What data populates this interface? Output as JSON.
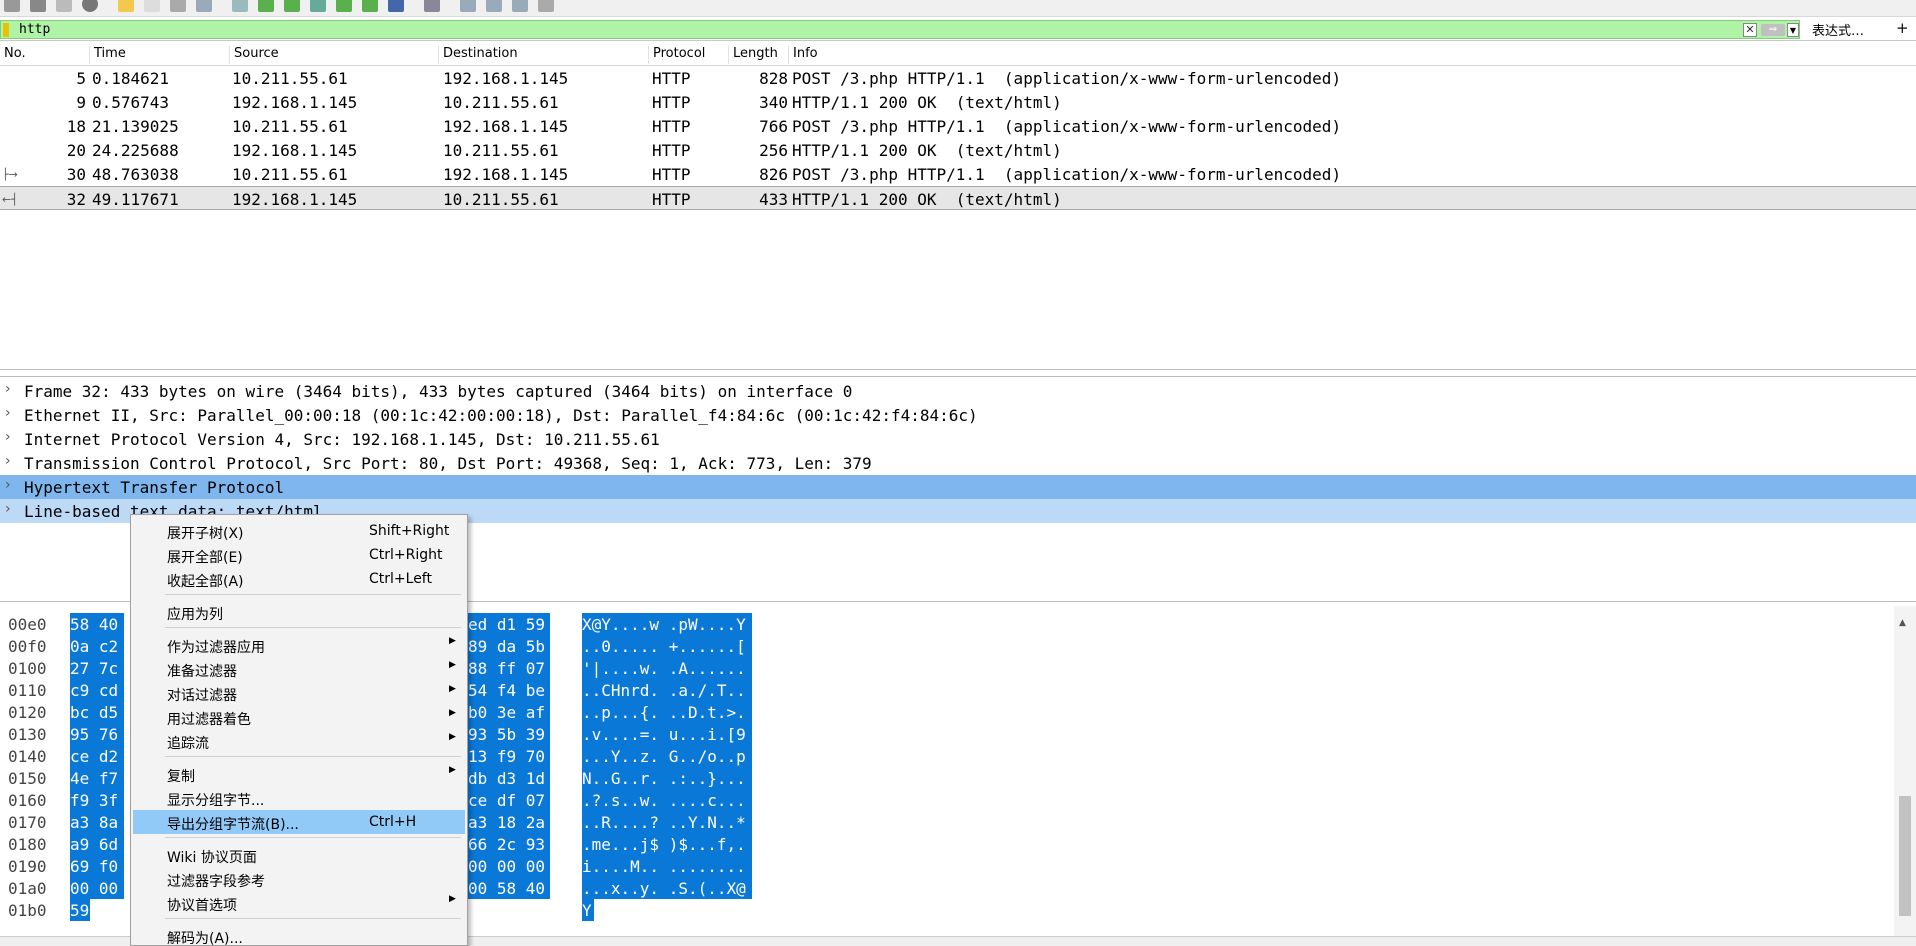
{
  "filter": {
    "value": "http",
    "expression_label": "表达式…",
    "add_label": "+"
  },
  "packet_list": {
    "columns": [
      "No.",
      "Time",
      "Source",
      "Destination",
      "Protocol",
      "Length",
      "Info"
    ],
    "rows": [
      {
        "no": "5",
        "time": "0.184621",
        "src": "10.211.55.61",
        "dst": "192.168.1.145",
        "proto": "HTTP",
        "len": "828",
        "info": "POST /3.php HTTP/1.1  (application/x-www-form-urlencoded)"
      },
      {
        "no": "9",
        "time": "0.576743",
        "src": "192.168.1.145",
        "dst": "10.211.55.61",
        "proto": "HTTP",
        "len": "340",
        "info": "HTTP/1.1 200 OK  (text/html)"
      },
      {
        "no": "18",
        "time": "21.139025",
        "src": "10.211.55.61",
        "dst": "192.168.1.145",
        "proto": "HTTP",
        "len": "766",
        "info": "POST /3.php HTTP/1.1  (application/x-www-form-urlencoded)"
      },
      {
        "no": "20",
        "time": "24.225688",
        "src": "192.168.1.145",
        "dst": "10.211.55.61",
        "proto": "HTTP",
        "len": "256",
        "info": "HTTP/1.1 200 OK  (text/html)"
      },
      {
        "no": "30",
        "time": "48.763038",
        "src": "10.211.55.61",
        "dst": "192.168.1.145",
        "proto": "HTTP",
        "len": "826",
        "info": "POST /3.php HTTP/1.1  (application/x-www-form-urlencoded)"
      },
      {
        "no": "32",
        "time": "49.117671",
        "src": "192.168.1.145",
        "dst": "10.211.55.61",
        "proto": "HTTP",
        "len": "433",
        "info": "HTTP/1.1 200 OK  (text/html)"
      }
    ],
    "selected_row_no": "32"
  },
  "details": [
    "Frame 32: 433 bytes on wire (3464 bits), 433 bytes captured (3464 bits) on interface 0",
    "Ethernet II, Src: Parallel_00:00:18 (00:1c:42:00:00:18), Dst: Parallel_f4:84:6c (00:1c:42:f4:84:6c)",
    "Internet Protocol Version 4, Src: 192.168.1.145, Dst: 10.211.55.61",
    "Transmission Control Protocol, Src Port: 80, Dst Port: 49368, Seq: 1, Ack: 773, Len: 379",
    "Hypertext Transfer Protocol",
    "Line-based text data: text/html"
  ],
  "hex": [
    {
      "off": "00e0",
      "left": "58 40",
      "right": "ed d1 59",
      "ascii": "X@Y....w .pW....Y"
    },
    {
      "off": "00f0",
      "left": "0a c2",
      "right": "89 da 5b",
      "ascii": "..0..... +......["
    },
    {
      "off": "0100",
      "left": "27 7c",
      "right": "88 ff 07",
      "ascii": "'|....w. .A......"
    },
    {
      "off": "0110",
      "left": "c9 cd",
      "right": "54 f4 be",
      "ascii": "..CHnrd. .a./.T.."
    },
    {
      "off": "0120",
      "left": "bc d5",
      "right": "b0 3e af",
      "ascii": "..p...{. ..D.t.>."
    },
    {
      "off": "0130",
      "left": "95 76",
      "right": "93 5b 39",
      "ascii": ".v....=. u...i.[9"
    },
    {
      "off": "0140",
      "left": "ce d2",
      "right": "13 f9 70",
      "ascii": "...Y..z. G../o..p"
    },
    {
      "off": "0150",
      "left": "4e f7",
      "right": "db d3 1d",
      "ascii": "N..G..r. .:..}..."
    },
    {
      "off": "0160",
      "left": "f9 3f",
      "right": "ce df 07",
      "ascii": ".?.s..w. ....c..."
    },
    {
      "off": "0170",
      "left": "a3 8a",
      "right": "a3 18 2a",
      "ascii": "..R....? ..Y.N..*"
    },
    {
      "off": "0180",
      "left": "a9 6d",
      "right": "66 2c 93",
      "ascii": ".me...j$ )$...f,."
    },
    {
      "off": "0190",
      "left": "69 f0",
      "right": "00 00 00",
      "ascii": "i....M.. ........"
    },
    {
      "off": "01a0",
      "left": "00 00",
      "right": "00 58 40",
      "ascii": "...x..y. .S.(..X@"
    },
    {
      "off": "01b0",
      "left": "59",
      "right": "",
      "ascii": "Y"
    }
  ],
  "context_menu": {
    "items": [
      {
        "label": "展开子树(X)",
        "shortcut": "Shift+Right",
        "submenu": false
      },
      {
        "label": "展开全部(E)",
        "shortcut": "Ctrl+Right",
        "submenu": false
      },
      {
        "label": "收起全部(A)",
        "shortcut": "Ctrl+Left",
        "submenu": false
      },
      {
        "label": "应用为列",
        "shortcut": "",
        "submenu": false
      },
      {
        "label": "作为过滤器应用",
        "shortcut": "",
        "submenu": true
      },
      {
        "label": "准备过滤器",
        "shortcut": "",
        "submenu": true
      },
      {
        "label": "对话过滤器",
        "shortcut": "",
        "submenu": true
      },
      {
        "label": "用过滤器着色",
        "shortcut": "",
        "submenu": true
      },
      {
        "label": "追踪流",
        "shortcut": "",
        "submenu": true
      },
      {
        "label": "复制",
        "shortcut": "",
        "submenu": true
      },
      {
        "label": "显示分组字节...",
        "shortcut": "",
        "submenu": false
      },
      {
        "label": "导出分组字节流(B)...",
        "shortcut": "Ctrl+H",
        "submenu": false
      },
      {
        "label": "Wiki 协议页面",
        "shortcut": "",
        "submenu": false
      },
      {
        "label": "过滤器字段参考",
        "shortcut": "",
        "submenu": false
      },
      {
        "label": "协议首选项",
        "shortcut": "",
        "submenu": true
      },
      {
        "label": "解码为(A)...",
        "shortcut": "",
        "submenu": false
      }
    ],
    "active_index": 11
  },
  "colors": {
    "filter_valid": "#aff3a6",
    "detail_highlight": "#7fb6ee",
    "hex_selection": "#0a78d7",
    "menu_active": "#91c9f7"
  }
}
